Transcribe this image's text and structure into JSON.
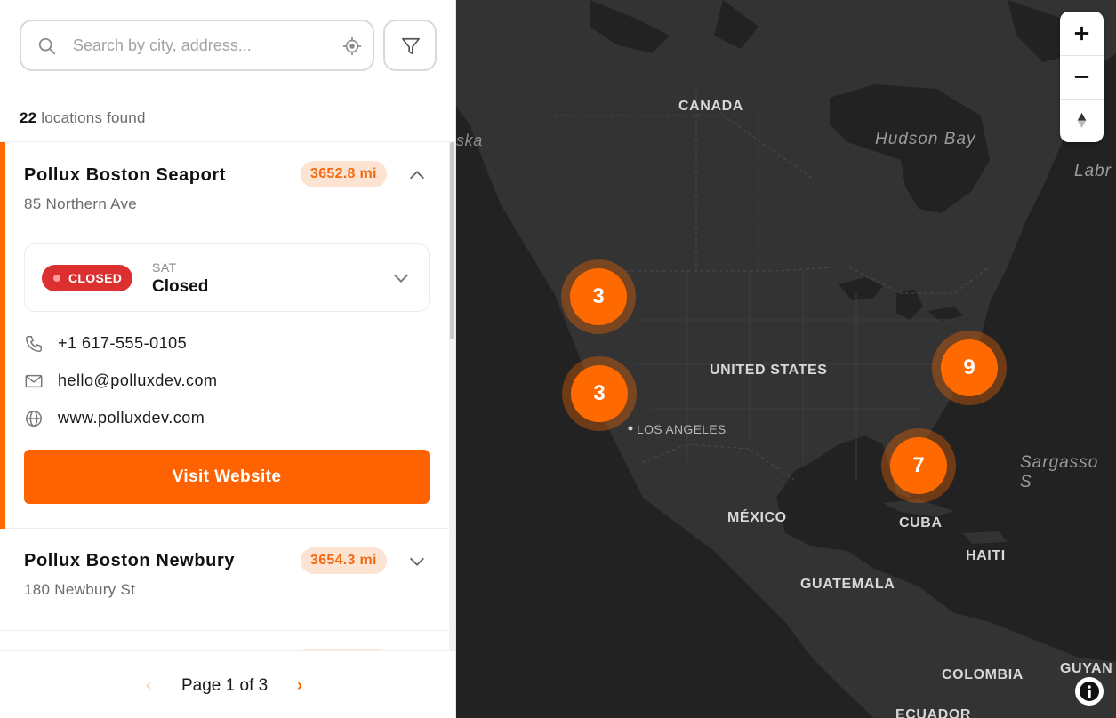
{
  "search": {
    "placeholder": "Search by city, address...",
    "value": ""
  },
  "results": {
    "count": "22",
    "label": "locations found"
  },
  "locations": [
    {
      "name": "Pollux Boston Seaport",
      "address": "85 Northern Ave",
      "distance": "3652.8 mi",
      "expanded": true,
      "status": "CLOSED",
      "day": "SAT",
      "hours": "Closed",
      "phone": "+1 617-555-0105",
      "email": "hello@polluxdev.com",
      "website": "www.polluxdev.com",
      "cta": "Visit Website"
    },
    {
      "name": "Pollux Boston Newbury",
      "address": "180 Newbury St",
      "distance": "3654.3 mi",
      "expanded": false
    }
  ],
  "pagination": {
    "prev": "‹",
    "text": "Page 1 of 3",
    "next": "›"
  },
  "map": {
    "labels": {
      "canada": "CANADA",
      "hudson_bay": "Hudson Bay",
      "labrador": "Labr",
      "alaska": "ska",
      "united_states": "UNITED STATES",
      "los_angeles": "LOS ANGELES",
      "mexico": "MÉXICO",
      "cuba": "CUBA",
      "haiti": "HAITI",
      "guatemala": "GUATEMALA",
      "colombia": "COLOMBIA",
      "guyana": "GUYAN",
      "ecuador": "ECUADOR",
      "sargasso": "Sargasso S"
    },
    "clusters": [
      {
        "id": "pacific-northwest",
        "count": "3"
      },
      {
        "id": "california",
        "count": "3"
      },
      {
        "id": "northeast",
        "count": "9"
      },
      {
        "id": "florida",
        "count": "7"
      }
    ]
  },
  "colors": {
    "accent": "#ff6a00",
    "badge_bg": "#fde3d1",
    "closed": "#dc2f2f",
    "map_bg": "#222222",
    "land": "#333333"
  }
}
